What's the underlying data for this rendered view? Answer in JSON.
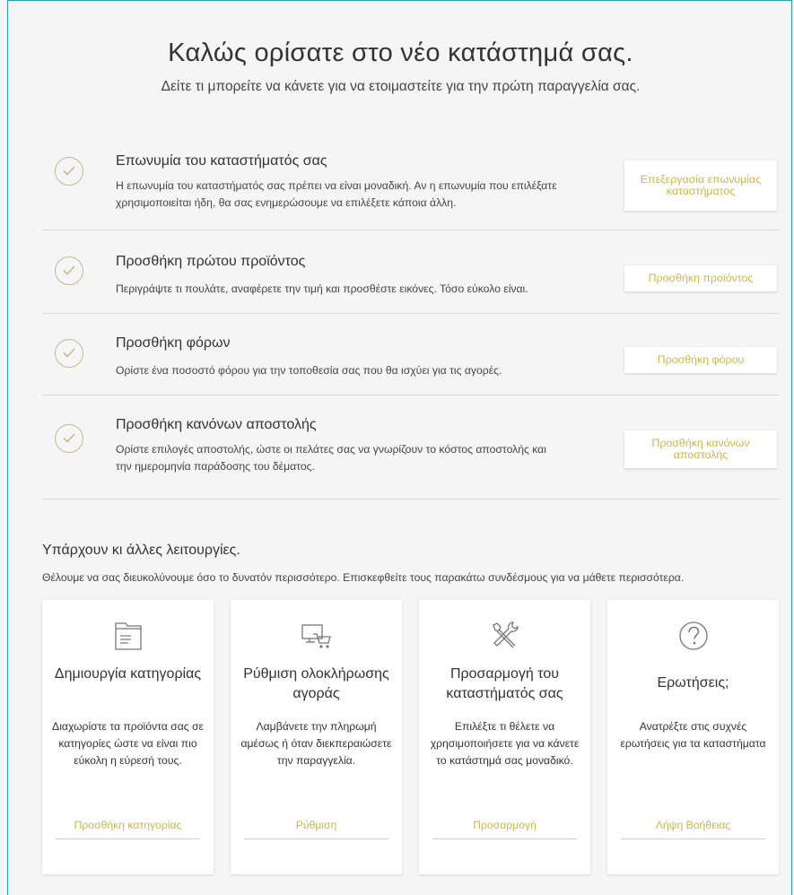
{
  "header": {
    "title": "Καλώς ορίσατε στο νέο κατάστημά σας.",
    "subtitle": "Δείτε τι μπορείτε να κάνετε για να ετοιμαστείτε για την πρώτη παραγγελία σας."
  },
  "steps": [
    {
      "title": "Επωνυμία του καταστήματός σας",
      "description_line1": "Η επωνυμία του καταστήματός σας πρέπει να είναι μοναδική. Αν η επωνυμία που επιλέξατε",
      "description_line2": "χρησιμοποιείται ήδη, θα σας ενημερώσουμε να επιλέξετε κάποια άλλη.",
      "button_label": "Επεξεργασία επωνυμίας καταστήματος"
    },
    {
      "title": "Προσθήκη πρώτου προϊόντος",
      "description_line1": "Περιγράψτε τι πουλάτε, αναφέρετε την τιμή και προσθέστε εικόνες. Τόσο εύκολο είναι.",
      "description_line2": "",
      "button_label": "Προσθήκη προϊόντος"
    },
    {
      "title": "Προσθήκη φόρων",
      "description_line1": "Ορίστε ένα ποσοστό φόρου για την τοποθεσία σας που θα ισχύει για τις αγορές.",
      "description_line2": "",
      "button_label": "Προσθήκη φόρου"
    },
    {
      "title": "Προσθήκη κανόνων αποστολής",
      "description_line1": "Ορίστε επιλογές αποστολής, ώστε οι πελάτες σας να γνωρίζουν το κόστος αποστολής και",
      "description_line2": "την ημερομηνία παράδοσης του δέματος.",
      "button_label": "Προσθήκη κανόνων αποστολής"
    }
  ],
  "more": {
    "title": "Υπάρχουν κι άλλες λειτουργίες.",
    "description": "Θέλουμε να σας διευκολύνουμε όσο το δυνατόν περισσότερο. Επισκεφθείτε τους παρακάτω συνδέσμους για να μάθετε περισσότερα."
  },
  "cards": [
    {
      "icon": "folder-icon",
      "title": "Δημιουργία κατηγορίας",
      "description": "Διαχωρίστε τα προϊόντα σας σε κατηγορίες ώστε να είναι πιο εύκολη η εύρεσή τους.",
      "link": "Προσθήκη κατηγορίας"
    },
    {
      "icon": "checkout-cart-icon",
      "title": "Ρύθμιση ολοκλήρωσης αγοράς",
      "description": "Λαμβάνετε την πληρωμή αμέσως ή όταν διεκπεραιώσετε την παραγγελία.",
      "link": "Ρύθμιση"
    },
    {
      "icon": "tools-icon",
      "title": "Προσαρμογή του καταστήματός σας",
      "description": "Επιλέξτε τι θέλετε να χρησιμοποιήσετε για να κάνετε το κατάστημά σας μοναδικό.",
      "link": "Προσαρμογή"
    },
    {
      "icon": "question-icon",
      "title": "Ερωτήσεις;",
      "description": "Ανατρέξτε στις συχνές ερωτήσεις για τα καταστήματα",
      "link": "Λήψη Βοήθειας"
    }
  ],
  "colors": {
    "accent": "#cdb64a",
    "check": "#bfbc8e",
    "frame": "#2c9cb0"
  }
}
